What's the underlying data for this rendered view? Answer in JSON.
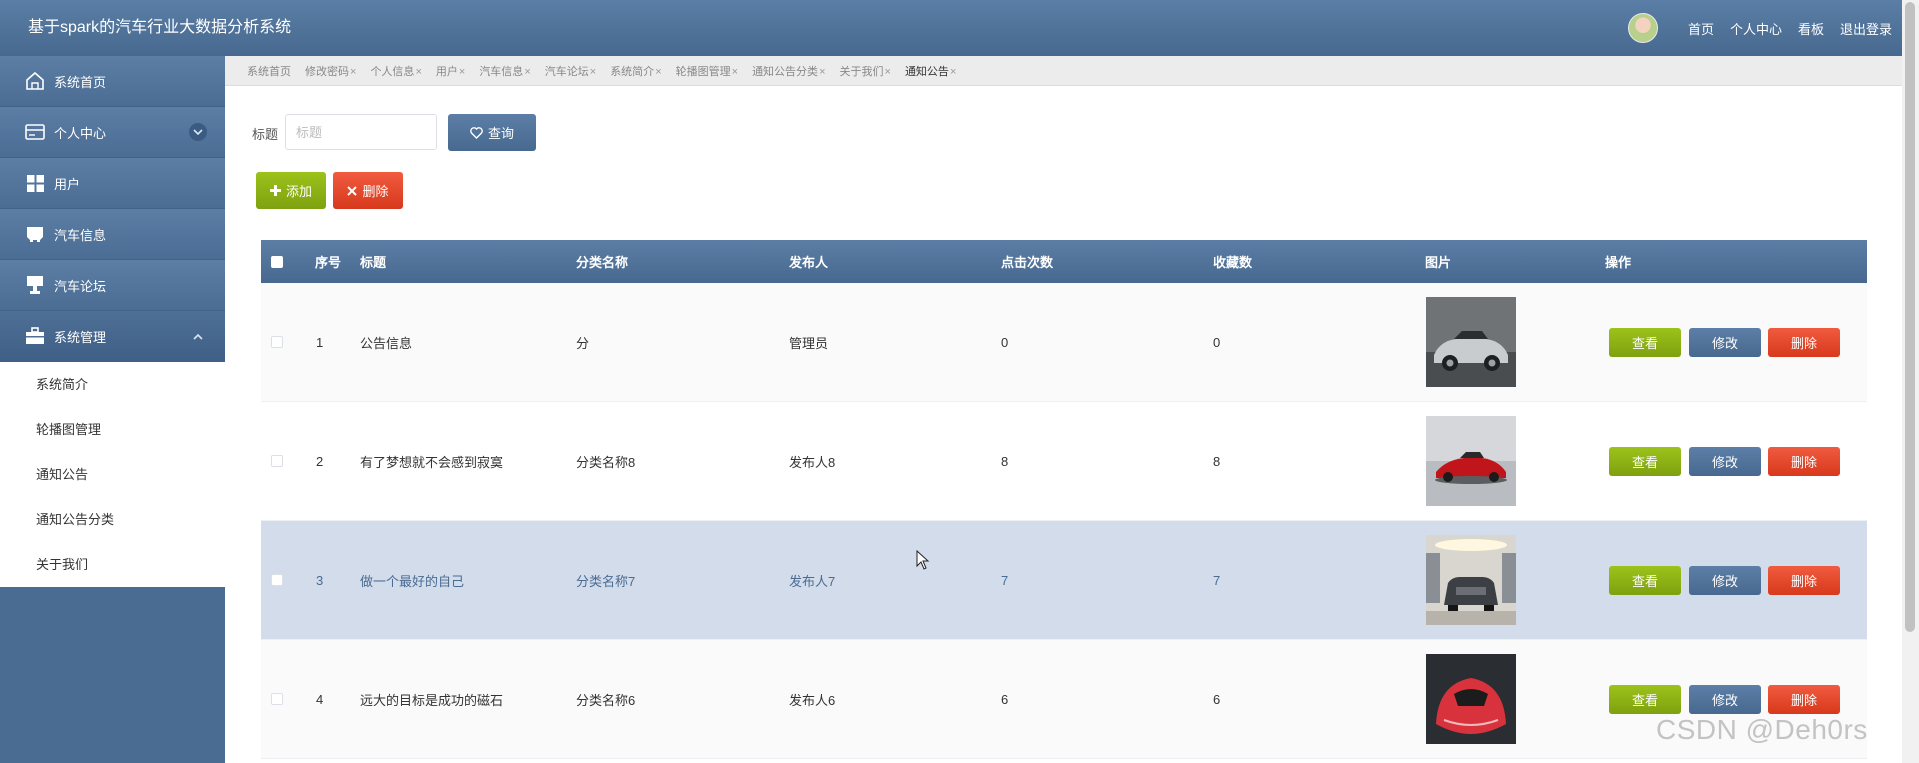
{
  "header": {
    "title": "基于spark的汽车行业大数据分析系统",
    "nav": [
      "首页",
      "个人中心",
      "看板",
      "退出登录"
    ]
  },
  "sidebar": {
    "items": [
      {
        "label": "系统首页",
        "icon": "home-icon"
      },
      {
        "label": "个人中心",
        "icon": "id-card-icon",
        "caret": "down"
      },
      {
        "label": "用户",
        "icon": "grid-icon"
      },
      {
        "label": "汽车信息",
        "icon": "car-icon"
      },
      {
        "label": "汽车论坛",
        "icon": "stamp-icon"
      },
      {
        "label": "系统管理",
        "icon": "briefcase-icon",
        "caret": "up"
      }
    ],
    "submenu": [
      "系统简介",
      "轮播图管理",
      "通知公告",
      "通知公告分类",
      "关于我们"
    ]
  },
  "tags": [
    {
      "label": "系统首页",
      "closable": false
    },
    {
      "label": "修改密码",
      "closable": true
    },
    {
      "label": "个人信息",
      "closable": true
    },
    {
      "label": "用户",
      "closable": true
    },
    {
      "label": "汽车信息",
      "closable": true
    },
    {
      "label": "汽车论坛",
      "closable": true
    },
    {
      "label": "系统简介",
      "closable": true
    },
    {
      "label": "轮播图管理",
      "closable": true
    },
    {
      "label": "通知公告分类",
      "closable": true
    },
    {
      "label": "关于我们",
      "closable": true
    },
    {
      "label": "通知公告",
      "closable": true
    }
  ],
  "tag_close": "×",
  "search": {
    "label": "标题",
    "placeholder": "标题",
    "value": "",
    "button": "查询"
  },
  "actions": {
    "add": "添加",
    "delete": "删除"
  },
  "table": {
    "columns": [
      "序号",
      "标题",
      "分类名称",
      "发布人",
      "点击次数",
      "收藏数",
      "图片",
      "操作"
    ],
    "row_buttons": {
      "view": "查看",
      "edit": "修改",
      "delete": "删除"
    },
    "rows": [
      {
        "index": "1",
        "title": "公告信息",
        "category": "分",
        "publisher": "管理员",
        "clicks": "0",
        "favorites": "0",
        "image": "car-silver-convertible"
      },
      {
        "index": "2",
        "title": "有了梦想就不会感到寂寞",
        "category": "分类名称8",
        "publisher": "发布人8",
        "clicks": "8",
        "favorites": "8",
        "image": "car-red-coupe"
      },
      {
        "index": "3",
        "title": "做一个最好的自己",
        "category": "分类名称7",
        "publisher": "发布人7",
        "clicks": "7",
        "favorites": "7",
        "image": "car-dark-suv"
      },
      {
        "index": "4",
        "title": "远大的目标是成功的磁石",
        "category": "分类名称6",
        "publisher": "发布人6",
        "clicks": "6",
        "favorites": "6",
        "image": "car-red-concept"
      }
    ]
  },
  "watermark": "CSDN @Deh0rs",
  "colors": {
    "primary": "#4a6b92",
    "success": "#8db317",
    "danger": "#e14a2d",
    "hover_row": "#d2dcea"
  }
}
